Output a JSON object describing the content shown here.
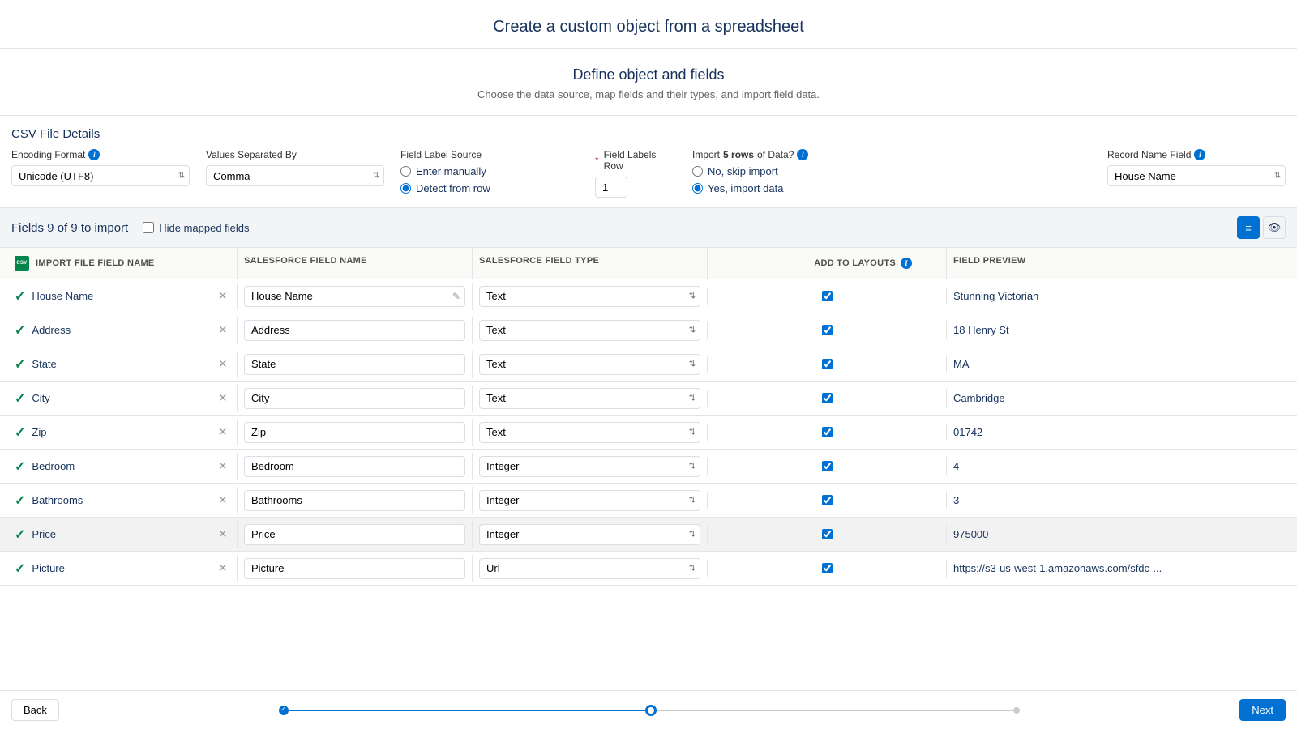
{
  "header": {
    "title": "Create a custom object from a spreadsheet",
    "subtitle": "Define object and fields",
    "description": "Choose the data source, map fields and their types, and import field data."
  },
  "csv": {
    "section_title": "CSV File Details",
    "encoding_label": "Encoding Format",
    "encoding_value": "Unicode (UTF8)",
    "separated_label": "Values Separated By",
    "separated_value": "Comma",
    "label_source_label": "Field Label Source",
    "manual_label": "Enter manually",
    "detect_label": "Detect from row",
    "labels_row_label": "Field Labels Row",
    "labels_row_value": "1",
    "import_label_pre": "Import ",
    "import_label_mid": "5 rows",
    "import_label_post": " of Data?",
    "skip_label": "No, skip import",
    "import_data_label": "Yes, import data",
    "record_name_label": "Record Name Field",
    "record_name_value": "House Name"
  },
  "fieldsbar": {
    "title": "Fields 9 of 9 to import",
    "hide_label": "Hide mapped fields"
  },
  "tableh": {
    "import_file": "IMPORT FILE FIELD NAME",
    "sf_name": "SALESFORCE FIELD NAME",
    "sf_type": "SALESFORCE FIELD TYPE",
    "add_layouts": "ADD TO LAYOUTS",
    "preview": "FIELD PREVIEW"
  },
  "rows": [
    {
      "file": "House Name",
      "sf": "House Name",
      "type": "Text",
      "preview": "Stunning Victorian",
      "edit": true
    },
    {
      "file": "Address",
      "sf": "Address",
      "type": "Text",
      "preview": "18 Henry St"
    },
    {
      "file": "State",
      "sf": "State",
      "type": "Text",
      "preview": "MA"
    },
    {
      "file": "City",
      "sf": "City",
      "type": "Text",
      "preview": "Cambridge"
    },
    {
      "file": "Zip",
      "sf": "Zip",
      "type": "Text",
      "preview": "01742"
    },
    {
      "file": "Bedroom",
      "sf": "Bedroom",
      "type": "Integer",
      "preview": "4"
    },
    {
      "file": "Bathrooms",
      "sf": "Bathrooms",
      "type": "Integer",
      "preview": "3"
    },
    {
      "file": "Price",
      "sf": "Price",
      "type": "Integer",
      "preview": "975000",
      "hover": true
    },
    {
      "file": "Picture",
      "sf": "Picture",
      "type": "Url",
      "preview": "https://s3-us-west-1.amazonaws.com/sfdc-..."
    }
  ],
  "footer": {
    "back": "Back",
    "next": "Next"
  }
}
